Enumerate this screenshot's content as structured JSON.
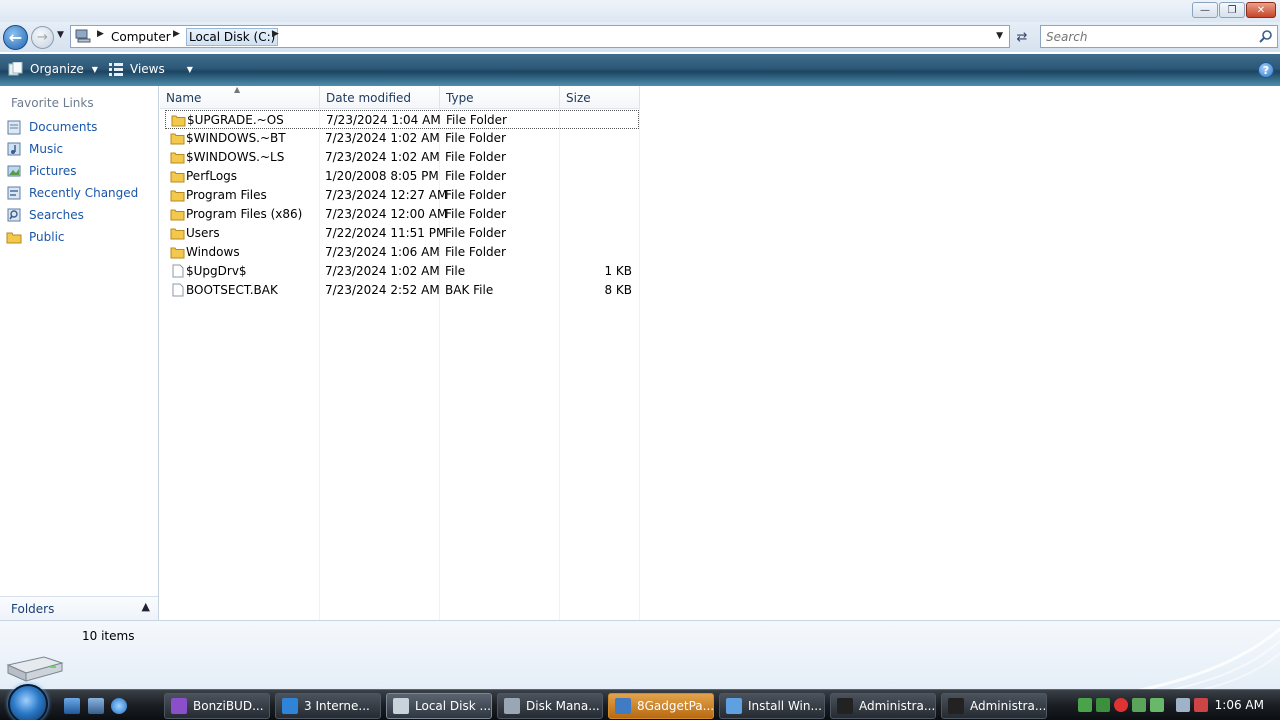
{
  "window": {
    "controls": {
      "minimize": "—",
      "maximize": "❐",
      "close": "✕"
    }
  },
  "address": {
    "crumbs": [
      "Computer",
      "Local Disk (C:)"
    ],
    "search_placeholder": "Search"
  },
  "toolbar": {
    "organize_label": "Organize",
    "views_label": "Views",
    "help_label": "?"
  },
  "nav": {
    "favorite_links_header": "Favorite Links",
    "items": [
      {
        "label": "Documents",
        "icon": "documents-icon"
      },
      {
        "label": "Music",
        "icon": "music-icon"
      },
      {
        "label": "Pictures",
        "icon": "pictures-icon"
      },
      {
        "label": "Recently Changed",
        "icon": "recently-changed-icon"
      },
      {
        "label": "Searches",
        "icon": "searches-icon"
      },
      {
        "label": "Public",
        "icon": "public-folder-icon"
      }
    ],
    "folders_label": "Folders"
  },
  "files": {
    "columns": [
      "Name",
      "Date modified",
      "Type",
      "Size"
    ],
    "rows": [
      {
        "name": "$UPGRADE.~OS",
        "date": "7/23/2024 1:04 AM",
        "type": "File Folder",
        "size": "",
        "kind": "folder"
      },
      {
        "name": "$WINDOWS.~BT",
        "date": "7/23/2024 1:02 AM",
        "type": "File Folder",
        "size": "",
        "kind": "folder"
      },
      {
        "name": "$WINDOWS.~LS",
        "date": "7/23/2024 1:02 AM",
        "type": "File Folder",
        "size": "",
        "kind": "folder"
      },
      {
        "name": "PerfLogs",
        "date": "1/20/2008 8:05 PM",
        "type": "File Folder",
        "size": "",
        "kind": "folder"
      },
      {
        "name": "Program Files",
        "date": "7/23/2024 12:27 AM",
        "type": "File Folder",
        "size": "",
        "kind": "folder"
      },
      {
        "name": "Program Files (x86)",
        "date": "7/23/2024 12:00 AM",
        "type": "File Folder",
        "size": "",
        "kind": "folder"
      },
      {
        "name": "Users",
        "date": "7/22/2024 11:51 PM",
        "type": "File Folder",
        "size": "",
        "kind": "folder"
      },
      {
        "name": "Windows",
        "date": "7/23/2024 1:06 AM",
        "type": "File Folder",
        "size": "",
        "kind": "folder"
      },
      {
        "name": "$UpgDrv$",
        "date": "7/23/2024 1:02 AM",
        "type": "File",
        "size": "1 KB",
        "kind": "file"
      },
      {
        "name": "BOOTSECT.BAK",
        "date": "7/23/2024 2:52 AM",
        "type": "BAK File",
        "size": "8 KB",
        "kind": "file"
      }
    ]
  },
  "details": {
    "item_count": "10 items"
  },
  "taskbar": {
    "buttons": [
      {
        "label": "BonziBUD...",
        "icon": "bonzibuddy-icon",
        "state": "normal"
      },
      {
        "label": "3 Interne...",
        "icon": "internet-explorer-icon",
        "state": "normal",
        "has_menu": true
      },
      {
        "label": "Local Disk ...",
        "icon": "explorer-drive-icon",
        "state": "active"
      },
      {
        "label": "Disk Mana...",
        "icon": "disk-management-icon",
        "state": "normal"
      },
      {
        "label": "8GadgetPa...",
        "icon": "gadget-pack-icon",
        "state": "flash"
      },
      {
        "label": "Install Win...",
        "icon": "install-windows-icon",
        "state": "normal"
      },
      {
        "label": "Administra...",
        "icon": "command-prompt-icon",
        "state": "normal"
      },
      {
        "label": "Administra...",
        "icon": "command-prompt-icon",
        "state": "normal"
      }
    ],
    "clock": "1:06 AM"
  }
}
